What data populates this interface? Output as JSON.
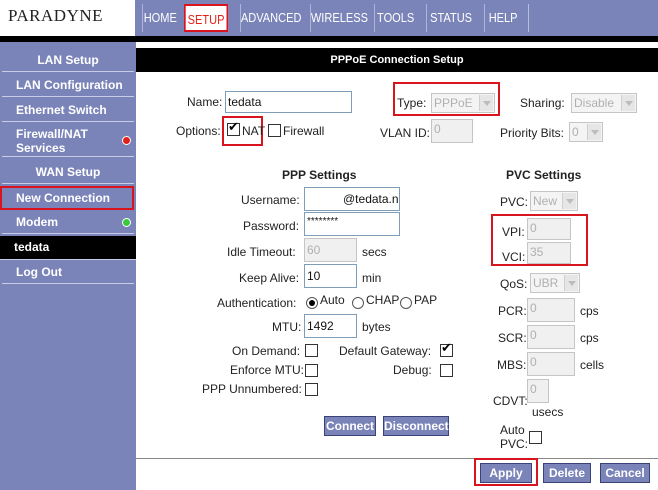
{
  "brand": {
    "logo": "PARADYNE"
  },
  "nav": {
    "tabs": [
      "HOME",
      "SETUP",
      "ADVANCED",
      "WIRELESS",
      "TOOLS",
      "STATUS",
      "HELP"
    ]
  },
  "sidebar": {
    "items": [
      "LAN Setup",
      "LAN Configuration",
      "Ethernet Switch",
      "Firewall/NAT Services",
      "WAN Setup",
      "New Connection",
      "Modem",
      "tedata",
      "Log Out"
    ]
  },
  "page": {
    "title": "PPPoE Connection Setup"
  },
  "form": {
    "name_label": "Name:",
    "name_value": "tedata",
    "type_label": "Type:",
    "type_value": "PPPoE",
    "sharing_label": "Sharing:",
    "sharing_value": "Disable",
    "options_label": "Options:",
    "nat_label": "NAT",
    "firewall_label": "Firewall",
    "vlan_label": "VLAN ID:",
    "vlan_value": "0",
    "priority_label": "Priority Bits:",
    "priority_value": "0"
  },
  "ppp": {
    "heading": "PPP Settings",
    "username_label": "Username:",
    "username_value": "@tedata.ne",
    "password_label": "Password:",
    "password_value": "********",
    "idle_label": "Idle Timeout:",
    "idle_value": "60",
    "idle_unit": "secs",
    "keepalive_label": "Keep Alive:",
    "keepalive_value": "10",
    "keepalive_unit": "min",
    "auth_label": "Authentication:",
    "auth_auto": "Auto",
    "auth_chap": "CHAP",
    "auth_pap": "PAP",
    "mtu_label": "MTU:",
    "mtu_value": "1492",
    "mtu_unit": "bytes",
    "ondemand_label": "On Demand:",
    "defgw_label": "Default Gateway:",
    "enforce_label": "Enforce MTU:",
    "debug_label": "Debug:",
    "unnumbered_label": "PPP Unnumbered:"
  },
  "pvc": {
    "heading": "PVC Settings",
    "pvc_label": "PVC:",
    "pvc_value": "New",
    "vpi_label": "VPI:",
    "vpi_value": "0",
    "vci_label": "VCI:",
    "vci_value": "35",
    "qos_label": "QoS:",
    "qos_value": "UBR",
    "pcr_label": "PCR:",
    "pcr_value": "0",
    "pcr_unit": "cps",
    "scr_label": "SCR:",
    "scr_value": "0",
    "scr_unit": "cps",
    "mbs_label": "MBS:",
    "mbs_value": "0",
    "mbs_unit": "cells",
    "cdvt_label": "CDVT:",
    "cdvt_value": "0",
    "cdvt_unit": "usecs",
    "autopvc_label1": "Auto",
    "autopvc_label2": "PVC:"
  },
  "buttons": {
    "connect": "Connect",
    "disconnect": "Disconnect",
    "apply": "Apply",
    "delete": "Delete",
    "cancel": "Cancel"
  },
  "colors": {
    "nav_bg": "#7b84b8",
    "highlight": "#d8141f",
    "status_red": "#e0201a",
    "status_green": "#3cc83c"
  }
}
